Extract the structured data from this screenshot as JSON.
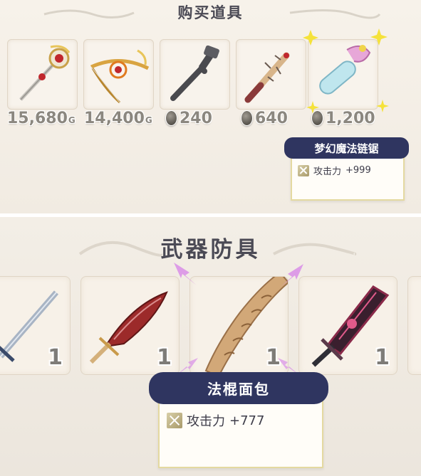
{
  "shop": {
    "title": "购买道具",
    "items": [
      {
        "icon": "ornate-staff-icon",
        "price": "15,680",
        "currency_suffix": "G"
      },
      {
        "icon": "golden-bow-icon",
        "price": "14,400",
        "currency_suffix": "G"
      },
      {
        "icon": "pipe-icon",
        "price": "240",
        "currency_icon": "coin-icon"
      },
      {
        "icon": "spiked-club-icon",
        "price": "640",
        "currency_icon": "coin-icon"
      },
      {
        "icon": "chainsaw-icon",
        "price": "1,200",
        "currency_icon": "coin-icon",
        "selected": true
      }
    ],
    "tooltip": {
      "name": "梦幻魔法链锯",
      "stat_label": "攻击力",
      "stat_value": "+999"
    }
  },
  "weapons": {
    "title": "武器防具",
    "items": [
      {
        "icon": "sword-icon",
        "count": "1"
      },
      {
        "icon": "crimson-scimitar-icon",
        "count": "1"
      },
      {
        "icon": "baguette-staff-icon",
        "count": "1",
        "selected": true
      },
      {
        "icon": "dark-greatsword-icon",
        "count": "1"
      }
    ],
    "tooltip": {
      "name": "法棍面包",
      "stat_label": "攻击力",
      "stat_value": "+777"
    }
  },
  "colors": {
    "banner": "#2f3560",
    "tooltip_border": "#e4d9a0",
    "highlight_yellow": "#f5e23a",
    "highlight_pink": "#d98ee8"
  }
}
